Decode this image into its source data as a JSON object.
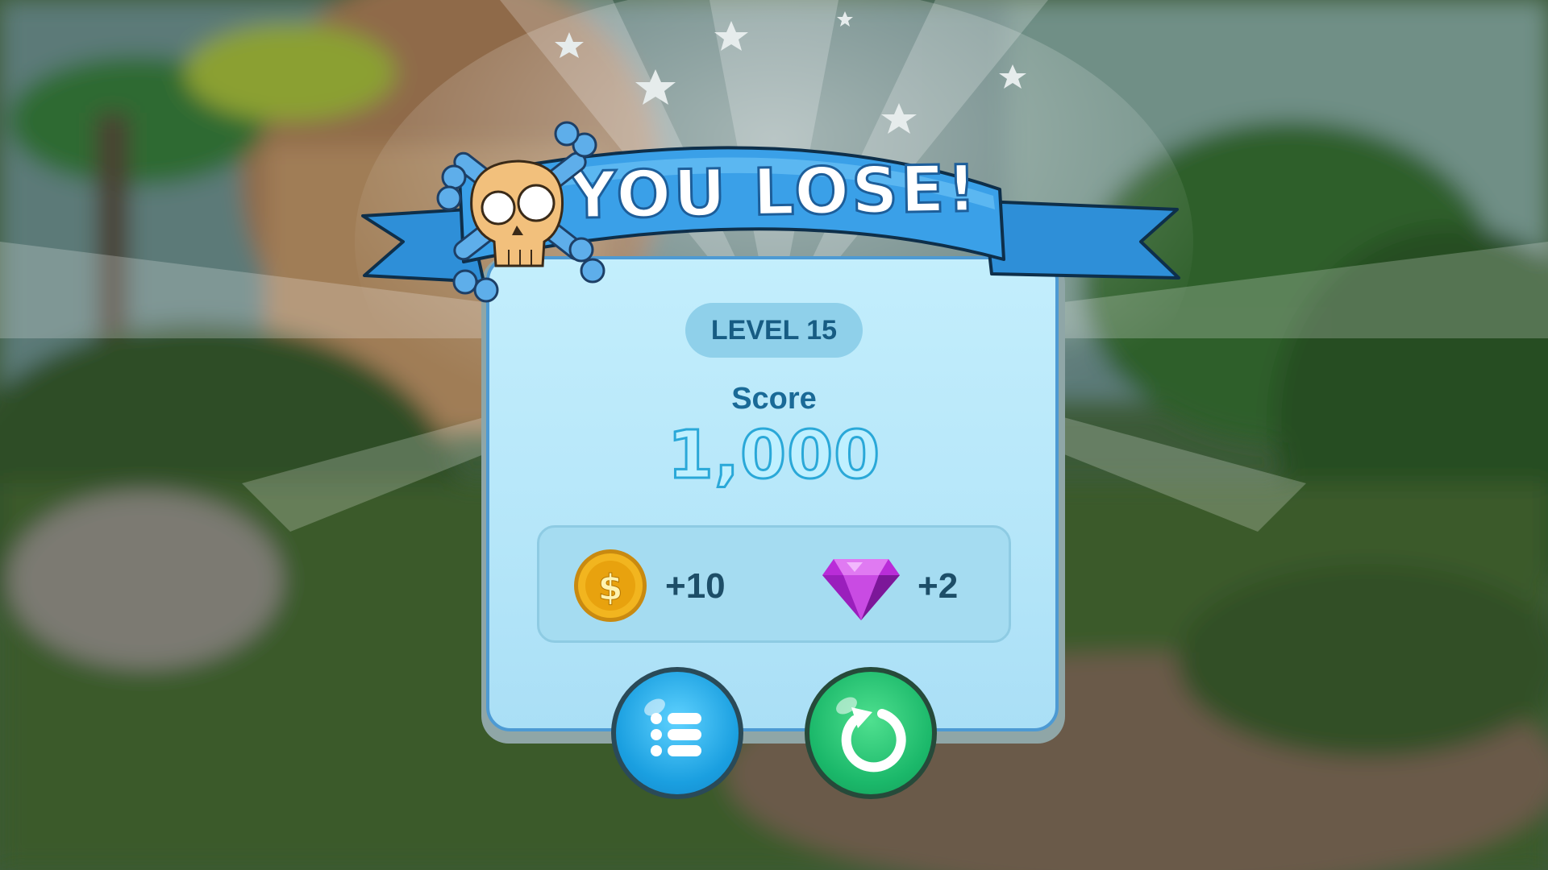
{
  "title": "YOU LOSE!",
  "level_label": "LEVEL 15",
  "score": {
    "label": "Score",
    "value": "1,000"
  },
  "rewards": [
    {
      "icon": "coin-icon",
      "amount": "+10"
    },
    {
      "icon": "gem-icon",
      "amount": "+2"
    }
  ],
  "buttons": [
    {
      "icon": "list-icon",
      "purpose": "level menu"
    },
    {
      "icon": "restart-icon",
      "purpose": "retry level"
    }
  ],
  "colors": {
    "panel": "#b8e8fa",
    "panel_border": "#4d9ad3",
    "ribbon": "#3aa0e8",
    "score_text": "#2aa8d8",
    "list_button": "#1a9fe0",
    "retry_button": "#1bb86a",
    "gem": "#b92dd8",
    "coin": "#f2b51f"
  }
}
